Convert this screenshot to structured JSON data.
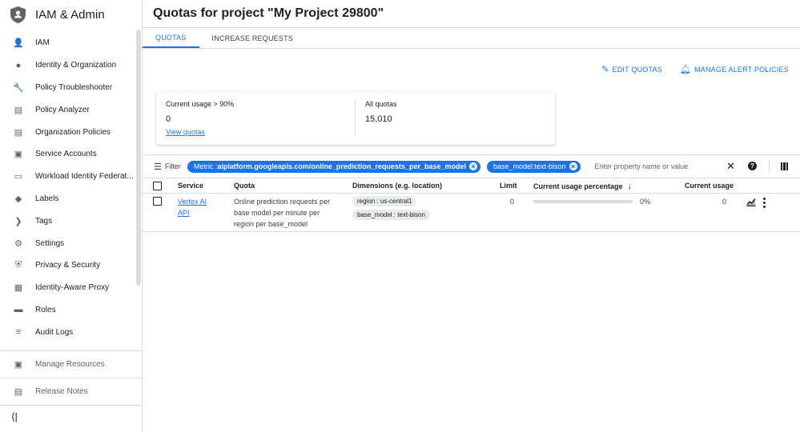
{
  "sidebar": {
    "title": "IAM & Admin",
    "items": [
      {
        "label": "IAM",
        "icon": "person-add-icon",
        "glyph": "👤"
      },
      {
        "label": "Identity & Organization",
        "icon": "account-circle-icon",
        "glyph": "●"
      },
      {
        "label": "Policy Troubleshooter",
        "icon": "wrench-icon",
        "glyph": "🔧"
      },
      {
        "label": "Policy Analyzer",
        "icon": "document-search-icon",
        "glyph": "▤"
      },
      {
        "label": "Organization Policies",
        "icon": "list-document-icon",
        "glyph": "▤"
      },
      {
        "label": "Service Accounts",
        "icon": "service-account-icon",
        "glyph": "▣"
      },
      {
        "label": "Workload Identity Federat...",
        "icon": "id-card-icon",
        "glyph": "▭"
      },
      {
        "label": "Labels",
        "icon": "label-icon",
        "glyph": "◆"
      },
      {
        "label": "Tags",
        "icon": "tag-arrow-icon",
        "glyph": "❯"
      },
      {
        "label": "Settings",
        "icon": "gear-icon",
        "glyph": "⚙"
      },
      {
        "label": "Privacy & Security",
        "icon": "shield-icon",
        "glyph": "⛨"
      },
      {
        "label": "Identity-Aware Proxy",
        "icon": "proxy-icon",
        "glyph": "▦"
      },
      {
        "label": "Roles",
        "icon": "roles-hat-icon",
        "glyph": "▬"
      },
      {
        "label": "Audit Logs",
        "icon": "lines-icon",
        "glyph": "≡"
      }
    ],
    "bottom": {
      "manage_resources": "Manage Resources",
      "release_notes": "Release Notes"
    },
    "collapse_glyph": "⟨|"
  },
  "page": {
    "title_prefix": "Quotas for ",
    "title_bold": "project",
    "title_suffix": " \"My Project 29800\""
  },
  "tabs": [
    {
      "label": "QUOTAS",
      "active": true
    },
    {
      "label": "INCREASE REQUESTS",
      "active": false
    }
  ],
  "actions": {
    "edit_quotas": "EDIT QUOTAS",
    "manage_alerts": "MANAGE ALERT POLICIES"
  },
  "summary": {
    "usage_label": "Current usage > 90%",
    "usage_value": "0",
    "view_link": "View quotas",
    "all_label": "All quotas",
    "all_value": "15,010"
  },
  "filter": {
    "label": "Filter",
    "chip1_key": "Metric : ",
    "chip1_value": "aiplatform.googleapis.com/online_prediction_requests_per_base_model",
    "chip2": "base_model:text-bison",
    "placeholder": "Enter property name or value",
    "help": "?"
  },
  "table": {
    "headers": {
      "service": "Service",
      "quota": "Quota",
      "dimensions": "Dimensions (e.g. location)",
      "limit": "Limit",
      "usage_pct": "Current usage percentage",
      "usage": "Current usage"
    },
    "row": {
      "service_line1": "Vertex AI",
      "service_line2": "API",
      "quota_line1": "Online prediction requests per",
      "quota_line2": "base model per minute per",
      "quota_line3": "region per base_model",
      "dim1": "region : us-central1",
      "dim2": "base_model : text-bison",
      "limit": "0",
      "usage_pct_label": "0%",
      "usage_fraction": 0,
      "usage": "0"
    }
  },
  "colors": {
    "accent": "#1a73e8",
    "divider": "#dadce0"
  }
}
